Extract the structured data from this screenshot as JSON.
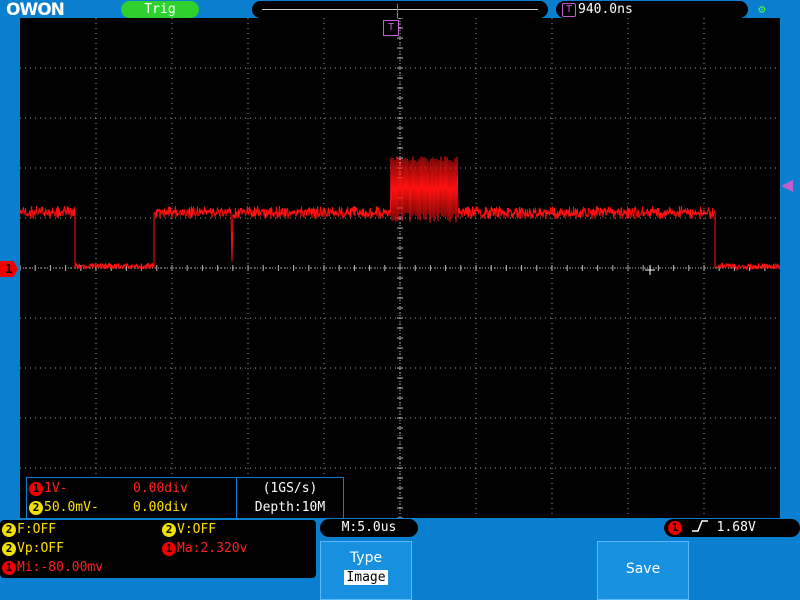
{
  "header": {
    "logo": "OWON",
    "trigger_status": "Trig",
    "trigger_time": "940.0ns",
    "trigger_badge": "T"
  },
  "screen": {
    "ch1_marker": "1",
    "trigger_pos_marker": "T"
  },
  "channel_info": {
    "ch1": {
      "badge": "1",
      "scale": "1V-",
      "offset": "0.00div"
    },
    "ch2": {
      "badge": "2",
      "scale": "50.0mV-",
      "offset": "0.00div"
    },
    "sample_rate": "(1GS/s)",
    "depth": "Depth:10M"
  },
  "measurements": [
    {
      "badge": "2",
      "text": "F:OFF",
      "color": "#ffe000"
    },
    {
      "badge": "2",
      "text": "V:OFF",
      "color": "#ffe000"
    },
    {
      "badge": "2",
      "text": "Vp:OFF",
      "color": "#ffe000"
    },
    {
      "badge": "1",
      "text": "Ma:2.320v",
      "color": "#ff2020"
    },
    {
      "badge": "1",
      "text": "Mi:-80.00mv",
      "color": "#ff2020"
    }
  ],
  "timebase": "M:5.0us",
  "trigger_setting": {
    "badge": "1",
    "level": "1.68V",
    "edge": "rising-edge-icon"
  },
  "menu": {
    "type_label": "Type",
    "type_value": "Image",
    "save_label": "Save"
  },
  "colors": {
    "ch1": "#ff1010",
    "ch2": "#ffe000",
    "trigger": "#c060d0",
    "frame": "#0a7fd0",
    "screen": "#000000"
  }
}
